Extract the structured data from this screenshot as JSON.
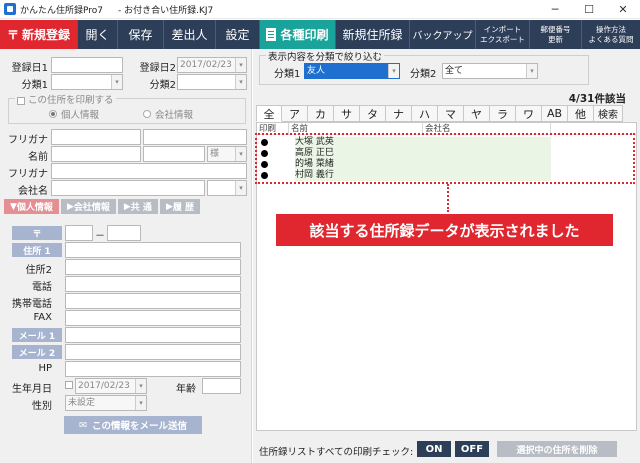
{
  "window": {
    "app_title": "かんたん住所録Pro7",
    "doc_title": "- お付き合い住所録.KJ7",
    "minimize": "─",
    "maximize": "☐",
    "close": "✕"
  },
  "toolbar": {
    "new_entry": "新規登録",
    "open": "開く",
    "save": "保存",
    "sender": "差出人",
    "settings": "設定",
    "print": "各種印刷",
    "new_addressbook": "新規住所録",
    "backup": "バックアップ",
    "import_line1": "インポート",
    "import_line2": "エクスポート",
    "postal_line1": "郵便番号",
    "postal_line2": "更新",
    "help_line1": "操作方法",
    "help_line2": "よくある質問"
  },
  "left": {
    "reg_date1_label": "登録日1",
    "reg_date2_label": "登録日2",
    "reg_date2_value": "2017/02/23",
    "cat1_label": "分類1",
    "cat2_label": "分類2",
    "print_group_title": "この住所を印刷する",
    "radio_personal": "個人情報",
    "radio_company": "会社情報",
    "furigana_label": "フリガナ",
    "name_label": "名前",
    "honorific_value": "様",
    "furigana2_label": "フリガナ",
    "company_label": "会社名",
    "tabs": [
      "個人情報",
      "会社情報",
      "共 通",
      "履 歴"
    ],
    "postal_btn": "〒",
    "postal_dash": "－",
    "address1_btn": "住所 1",
    "address2_label": "住所2",
    "phone_label": "電話",
    "mobile_label": "携帯電話",
    "fax_label": "FAX",
    "mail1_btn": "メール 1",
    "mail2_btn": "メール 2",
    "hp_label": "HP",
    "birthday_label": "生年月日",
    "birthday_value": "2017/02/23",
    "age_label": "年齢",
    "gender_label": "性別",
    "gender_value": "未設定",
    "mail_send_btn": "この情報をメール送信"
  },
  "right": {
    "filter_title": "表示内容を分類で絞り込む",
    "filter_cat1_label": "分類1",
    "filter_cat1_value": "友人",
    "filter_cat2_label": "分類2",
    "filter_cat2_value": "全て",
    "count": "4/31件該当",
    "kana_tabs": [
      "全",
      "ア",
      "カ",
      "サ",
      "タ",
      "ナ",
      "ハ",
      "マ",
      "ヤ",
      "ラ",
      "ワ",
      "AB",
      "他",
      "検索"
    ],
    "col_print": "印刷",
    "col_name": "名前",
    "col_company": "会社名",
    "rows": [
      {
        "name": "大塚 武英"
      },
      {
        "name": "高原 正巳"
      },
      {
        "name": "的場 菜緒"
      },
      {
        "name": "村岡 義行"
      }
    ],
    "banner": "該当する住所録データが表示されました",
    "footer_label": "住所録リストすべての印刷チェック:",
    "on_btn": "ON",
    "off_btn": "OFF",
    "delete_btn": "選択中の住所を削除"
  },
  "colors": {
    "toolbar_bg": "#2d3e58",
    "accent_red": "#e0262f",
    "accent_teal": "#1aa39a",
    "tab_active": "#e58f95",
    "row_band": "#eaf5e6"
  }
}
